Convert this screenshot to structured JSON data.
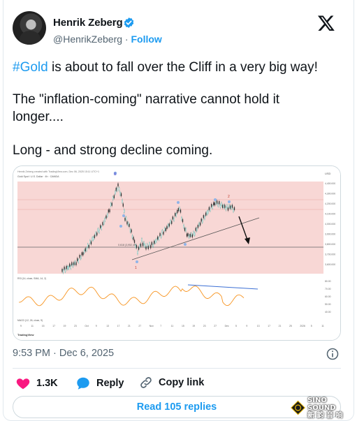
{
  "author": {
    "name": "Henrik Zeberg",
    "handle": "@HenrikZeberg",
    "separator": "·",
    "follow_label": "Follow"
  },
  "tweet": {
    "hashtag": "#Gold",
    "line1_rest": " is about to fall over the Cliff in a very big way!",
    "line2": "The \"inflation-coming\" narrative cannot hold it",
    "line3": "longer....",
    "line4": "Long - and strong decline coming."
  },
  "chart": {
    "top_note": "Henrik Zeberg created with TradingView.com, Dec 06, 2025 15:11 UTC+1",
    "symbol_line": "Gold Spot / U.S. Dollar · 4h · OANDA",
    "price_ticks": [
      "4,400.000",
      "4,300.000",
      "4,200.000",
      "4,100.000",
      "4,000.000",
      "3,900.000",
      "3,800.000",
      "3,700.000",
      "3,600.000"
    ],
    "indicator_ticks": [
      "80.00",
      "70.00",
      "60.00",
      "50.00",
      "40.00"
    ],
    "date_ticks": [
      "9",
      "11",
      "15",
      "17",
      "19",
      "23",
      "Oct",
      "9",
      "13",
      "17",
      "21",
      "27",
      "Nov",
      "7",
      "11",
      "15",
      "19",
      "23",
      "27",
      "Dec",
      "5",
      "9",
      "13",
      "17",
      "21",
      "25",
      "2026",
      "5",
      "11"
    ],
    "fib_label": "0.618 (3,952.48)",
    "wave_labels": [
      "B",
      "1",
      "2"
    ],
    "rsi_label": "RSI (14, close, SMA, 14, 2)",
    "macd_label": "MACD (12, 26, close, 9)",
    "brand": "TradingView",
    "usd_label": "USD"
  },
  "meta": {
    "timestamp": "9:53 PM · Dec 6, 2025"
  },
  "actions": {
    "likes": "1.3K",
    "reply": "Reply",
    "copy_link": "Copy link"
  },
  "replies_button": "Read 105 replies",
  "watermark": {
    "line1": "SINO SOUND",
    "line2": "新 韵 音 响"
  },
  "colors": {
    "accent": "#1d9bf0",
    "like": "#f91880",
    "text_secondary": "#536471",
    "chart_bg": "#f8d7d5",
    "rsi_line": "#f7931e"
  }
}
